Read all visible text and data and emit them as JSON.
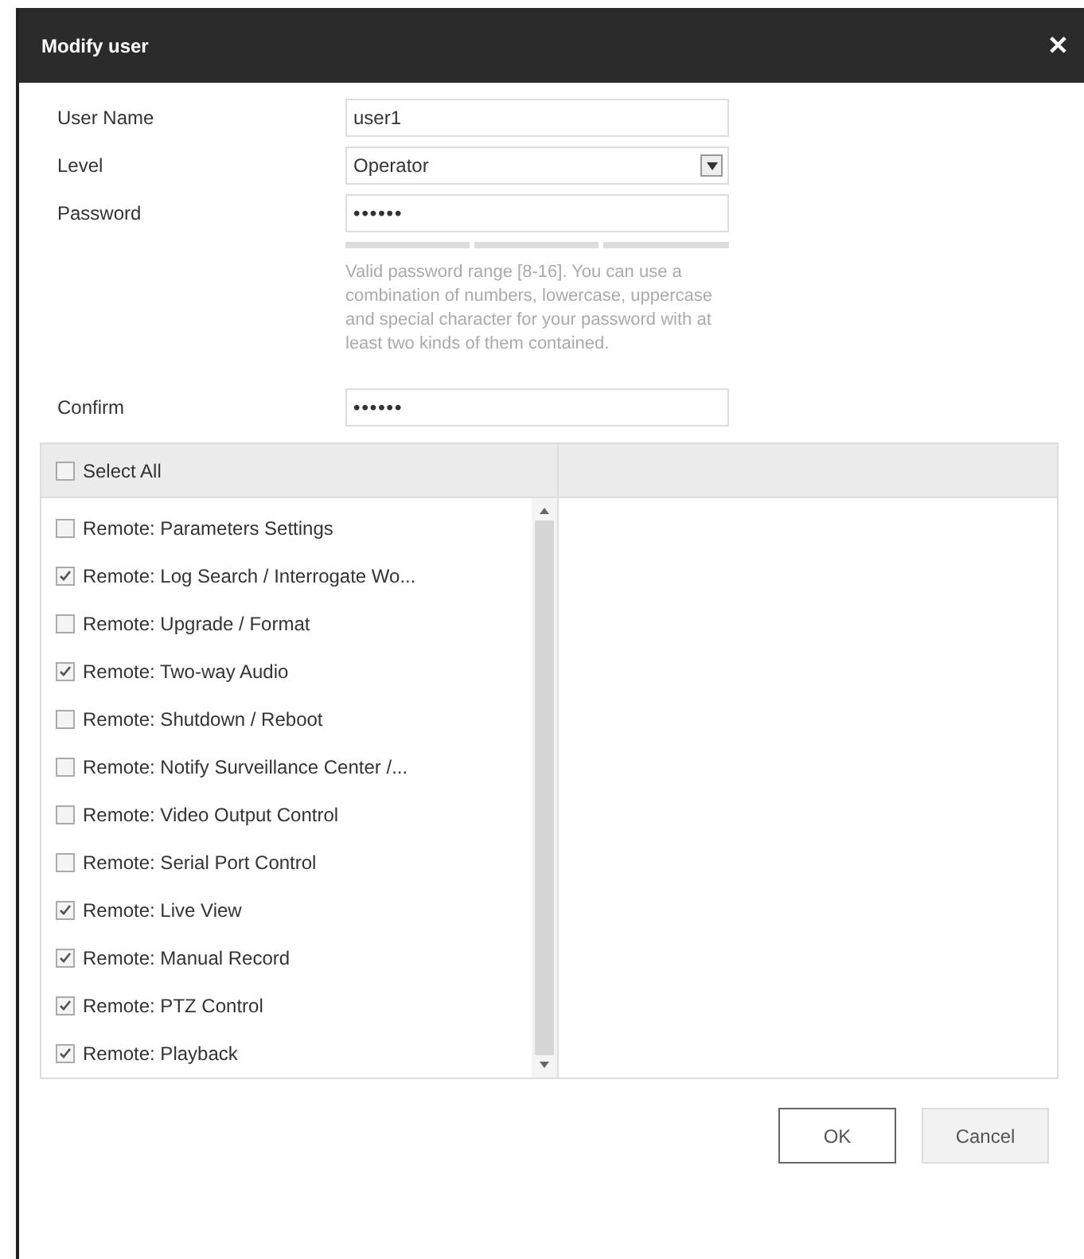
{
  "dialog": {
    "title": "Modify user",
    "close": "✕"
  },
  "fields": [
    {
      "label": "User Name",
      "kind": "text",
      "value": "user1"
    },
    {
      "label": "Level",
      "kind": "select",
      "value": "Operator"
    },
    {
      "label": "Password",
      "kind": "password",
      "value": "••••••",
      "hint": "Valid password range [8-16]. You can use a combination of numbers, lowercase, uppercase and special character for your password with at least two kinds of them contained."
    },
    {
      "label": "Confirm",
      "kind": "password",
      "value": "••••••"
    }
  ],
  "permissions": {
    "select_all": {
      "label": "Select All",
      "checked": false
    },
    "items": [
      {
        "label": "Remote: Parameters Settings",
        "checked": false
      },
      {
        "label": "Remote: Log Search / Interrogate Wo...",
        "checked": true
      },
      {
        "label": "Remote: Upgrade / Format",
        "checked": false
      },
      {
        "label": "Remote: Two-way Audio",
        "checked": true
      },
      {
        "label": "Remote: Shutdown / Reboot",
        "checked": false
      },
      {
        "label": "Remote: Notify Surveillance Center /...",
        "checked": false
      },
      {
        "label": "Remote: Video Output Control",
        "checked": false
      },
      {
        "label": "Remote: Serial Port Control",
        "checked": false
      },
      {
        "label": "Remote: Live View",
        "checked": true
      },
      {
        "label": "Remote: Manual Record",
        "checked": true
      },
      {
        "label": "Remote: PTZ Control",
        "checked": true
      },
      {
        "label": "Remote: Playback",
        "checked": true
      }
    ]
  },
  "buttons": [
    {
      "label": "OK",
      "kind": "primary"
    },
    {
      "label": "Cancel",
      "kind": "secondary"
    }
  ]
}
